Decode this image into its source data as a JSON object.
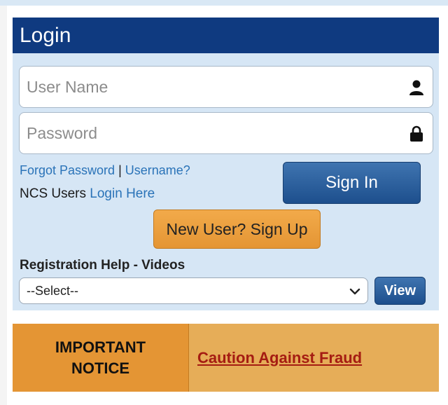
{
  "login": {
    "title": "Login",
    "username_placeholder": "User Name",
    "password_placeholder": "Password",
    "forgot_password": "Forgot Password",
    "separator": "|",
    "username_link": "Username?",
    "ncs_prefix": "NCS Users",
    "ncs_link": "Login Here",
    "signin_label": "Sign In",
    "signup_label": "New User? Sign Up"
  },
  "registration": {
    "label": "Registration Help - Videos",
    "selected_option": "--Select--",
    "view_label": "View"
  },
  "notice": {
    "title": "IMPORTANT NOTICE",
    "link": "Caution Against Fraud"
  },
  "icons": {
    "user": "user-icon",
    "lock": "lock-icon",
    "chevron": "chevron-down-icon"
  },
  "colors": {
    "header_bg": "#0f3a80",
    "panel_bg": "#d6e6f5",
    "accent_orange": "#e49534",
    "link_blue": "#2a73b8"
  }
}
